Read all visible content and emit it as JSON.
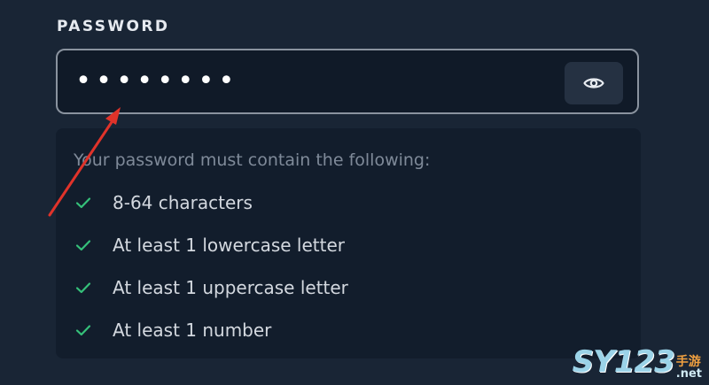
{
  "field": {
    "label": "PASSWORD",
    "value": "••••••••",
    "toggle_icon": "eye-icon"
  },
  "requirements": {
    "header": "Your password must contain the following:",
    "items": [
      {
        "label": "8-64 characters",
        "met": true
      },
      {
        "label": "At least 1 lowercase letter",
        "met": true
      },
      {
        "label": "At least 1 uppercase letter",
        "met": true
      },
      {
        "label": "At least 1 number",
        "met": true
      }
    ]
  },
  "annotation": {
    "arrow_color": "#e0332a"
  },
  "watermark": {
    "main": "SY123",
    "cn": "手游",
    "net": ".net"
  },
  "colors": {
    "background": "#192535",
    "check": "#35c17a"
  }
}
